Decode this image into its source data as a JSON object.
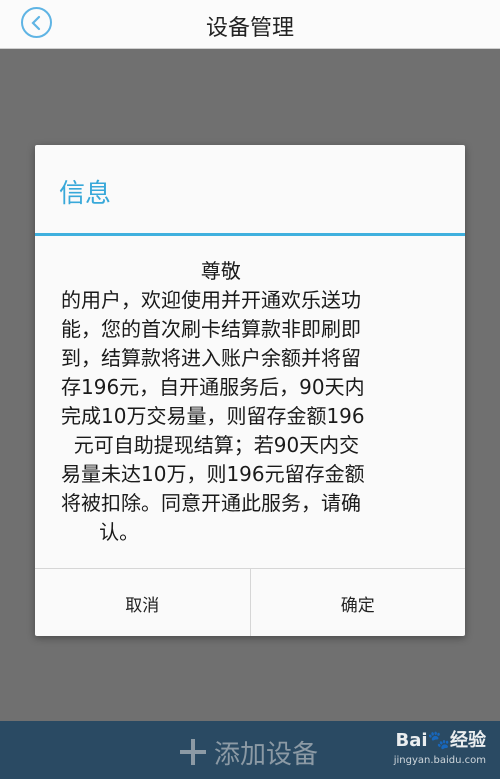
{
  "header": {
    "title": "设备管理",
    "back_icon": "chevron-left-icon"
  },
  "dialog": {
    "title": "信息",
    "message": "                      尊敬\n的用户，欢迎使用并开通欢乐送功\n能，您的首次刷卡结算款非即刷即\n到，结算款将进入账户余额并将留\n存196元，自开通服务后，90天内\n完成10万交易量，则留存金额196\n  元可自助提现结算；若90天内交\n易量未达10万，则196元留存金额\n将被扣除。同意开通此服务，请确\n      认。",
    "cancel_label": "取消",
    "confirm_label": "确定"
  },
  "bottom_bar": {
    "add_label": "添加设备",
    "add_icon": "plus-icon"
  },
  "watermark": {
    "brand": "Bai🐾经验",
    "url": "jingyan.baidu.com"
  },
  "colors": {
    "accent": "#38a8d9",
    "bottom_bar": "#2a4a63",
    "overlay": "#707070"
  }
}
